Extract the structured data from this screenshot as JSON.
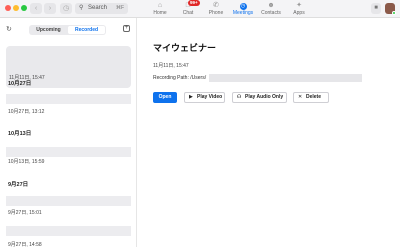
{
  "toolbar": {
    "search_label": "Search",
    "search_shortcut": "⌘F"
  },
  "nav": {
    "home": "Home",
    "chat": "Chat",
    "chat_badge": "99+",
    "phone": "Phone",
    "meetings": "Meetings",
    "contacts": "Contacts",
    "apps": "Apps"
  },
  "sidebar": {
    "tabs": [
      "Upcoming",
      "Recorded"
    ],
    "active_tab": "Recorded",
    "selected_item_time": "11月11日, 15:47",
    "groups": [
      {
        "header": "10月27日",
        "item_time": "10月27日, 13:12"
      },
      {
        "header": "10月13日",
        "item_time": "10月13日, 15:59"
      },
      {
        "header": "9月27日",
        "item_time": "9月27日, 15:01"
      },
      {
        "header": "",
        "item_time": "9月27日, 14:58"
      }
    ]
  },
  "detail": {
    "title": "マイウェビナー",
    "time": "11月11日, 15:47",
    "path_label": "Recording Path: /Users/",
    "buttons": {
      "open": "Open",
      "play_video": "Play Video",
      "play_audio": "Play Audio Only",
      "delete": "Delete"
    }
  },
  "colors": {
    "accent": "#0e72ed",
    "badge": "#e02828"
  }
}
